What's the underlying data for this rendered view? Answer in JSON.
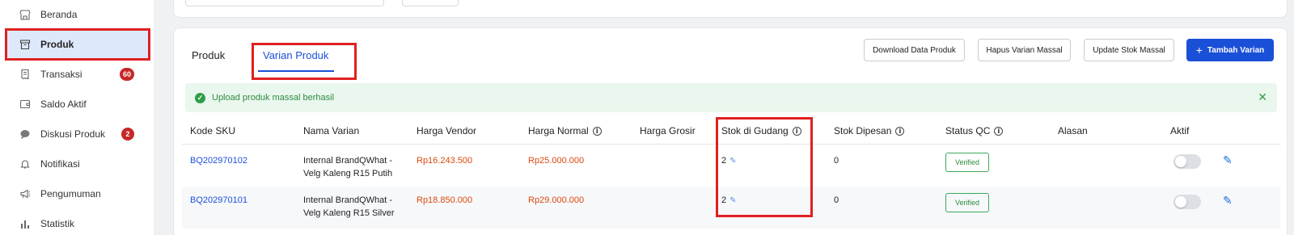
{
  "sidebar": {
    "items": [
      {
        "label": "Beranda",
        "icon": "store-icon"
      },
      {
        "label": "Produk",
        "icon": "box-icon",
        "active": true
      },
      {
        "label": "Transaksi",
        "icon": "receipt-icon",
        "badge": "60"
      },
      {
        "label": "Saldo Aktif",
        "icon": "wallet-icon"
      },
      {
        "label": "Diskusi Produk",
        "icon": "chat-icon",
        "badge": "2"
      },
      {
        "label": "Notifikasi",
        "icon": "bell-icon"
      },
      {
        "label": "Pengumuman",
        "icon": "megaphone-icon"
      },
      {
        "label": "Statistik",
        "icon": "bar-chart-icon"
      }
    ]
  },
  "tabs": {
    "produk": "Produk",
    "varian": "Varian Produk"
  },
  "actions": {
    "download": "Download Data Produk",
    "hapus": "Hapus Varian Massal",
    "update": "Update Stok Massal",
    "tambah": "Tambah Varian"
  },
  "alert": {
    "message": "Upload produk massal berhasil"
  },
  "table": {
    "headers": {
      "sku": "Kode SKU",
      "nama": "Nama Varian",
      "vendor": "Harga Vendor",
      "normal": "Harga Normal",
      "grosir": "Harga Grosir",
      "stok_gudang": "Stok di Gudang",
      "stok_dipesan": "Stok Dipesan",
      "status_qc": "Status QC",
      "alasan": "Alasan",
      "aktif": "Aktif"
    },
    "rows": [
      {
        "sku": "BQ202970102",
        "nama_line1": "Internal BrandQWhat -",
        "nama_line2": "Velg Kaleng R15 Putih",
        "vendor": "Rp16.243.500",
        "normal": "Rp25.000.000",
        "stok_gudang": "2",
        "stok_dipesan": "0",
        "status_qc": "Verified",
        "aktif": false
      },
      {
        "sku": "BQ202970101",
        "nama_line1": "Internal BrandQWhat -",
        "nama_line2": "Velg Kaleng R15 Silver",
        "vendor": "Rp18.850.000",
        "normal": "Rp29.000.000",
        "stok_gudang": "2",
        "stok_dipesan": "0",
        "status_qc": "Verified",
        "aktif": false
      }
    ]
  },
  "colors": {
    "primary": "#1a4fd8",
    "price": "#d9480f",
    "success": "#2e8b3e",
    "highlight": "#e02020",
    "badge": "#c62828"
  }
}
